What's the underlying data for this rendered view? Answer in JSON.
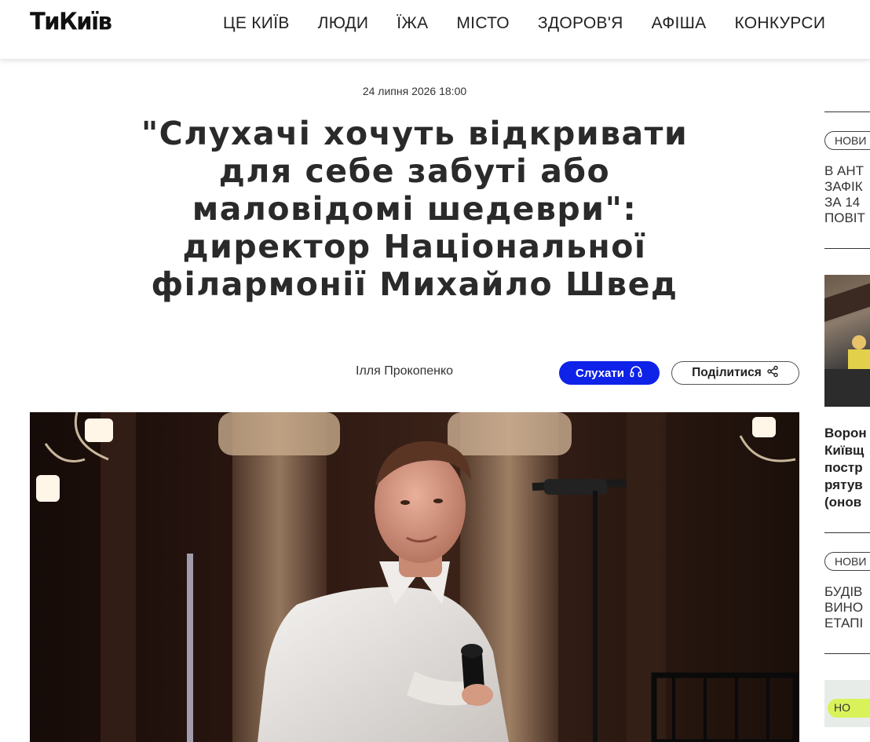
{
  "header": {
    "logo": "ТиКиїв",
    "nav": [
      "ЦЕ КИЇВ",
      "ЛЮДИ",
      "ЇЖА",
      "МІСТО",
      "ЗДОРОВ'Я",
      "АФІША",
      "КОНКУРСИ"
    ]
  },
  "article": {
    "date": "24 липня 2026 18:00",
    "title": "\"Слухачі хочуть відкривати для себе забуті або маловідомі шедеври\": директор Національної філармонії Михайло Швед",
    "author": "Ілля Прокопенко",
    "listen_label": "Слухати",
    "share_label": "Поділитися"
  },
  "sidebar": {
    "items": [
      {
        "tag": "НОВИ",
        "lines": [
          "В АНТ",
          "ЗАФІК",
          "ЗА 14",
          "ПОВІТ"
        ]
      },
      {
        "lines": [
          "Ворон",
          "Київщ",
          "постр",
          "рятув",
          "(онов"
        ]
      },
      {
        "tag": "НОВИ",
        "lines": [
          "БУДІВ",
          "ВИНО",
          "ЕТАПІ"
        ]
      },
      {
        "tag": "НО"
      }
    ]
  },
  "colors": {
    "accent": "#0e22e8",
    "text": "#222222",
    "tag_green": "#d9f25a"
  },
  "icons": {
    "listen": "headphones-icon",
    "share": "share-icon"
  }
}
